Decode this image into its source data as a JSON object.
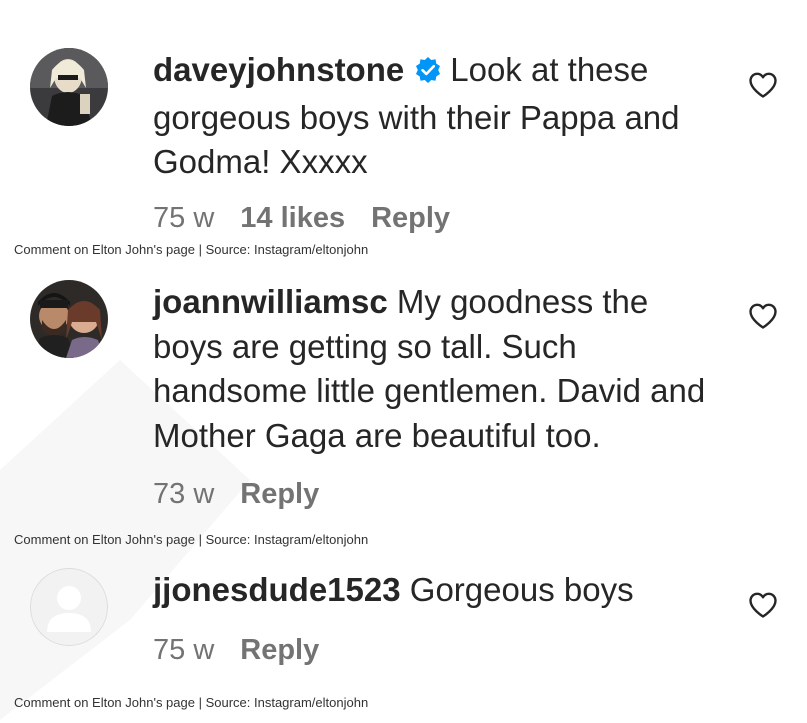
{
  "comments": [
    {
      "username": "daveyjohnstone",
      "verified": true,
      "text": "Look at these gorgeous boys with their Pappa and Godma! Xxxxx",
      "time": "75 w",
      "likes": "14 likes",
      "reply": "Reply",
      "caption": "Comment on Elton John's page | Source: Instagram/eltonjohn"
    },
    {
      "username": "joannwilliamsc",
      "verified": false,
      "text": "My goodness the boys are getting so tall. Such handsome little gentlemen. David and Mother Gaga are beautiful too.",
      "time": "73 w",
      "reply": "Reply",
      "caption": "Comment on Elton John's page | Source: Instagram/eltonjohn"
    },
    {
      "username": "jjonesdude1523",
      "verified": false,
      "text": "Gorgeous boys",
      "time": "75 w",
      "reply": "Reply",
      "caption": "Comment on Elton John's page | Source: Instagram/eltonjohn"
    }
  ],
  "colors": {
    "text": "#262626",
    "meta": "#737373",
    "verified": "#0095f6",
    "caption": "#333333"
  },
  "icons": {
    "like": "heart-outline-icon",
    "verified": "verified-badge-icon",
    "default_avatar": "default-avatar-icon"
  }
}
